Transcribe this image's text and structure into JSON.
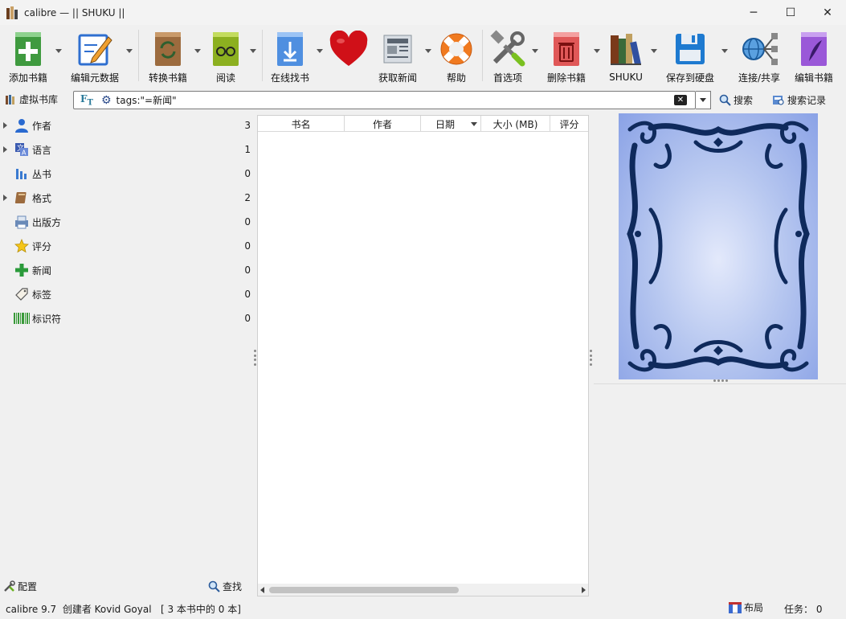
{
  "window": {
    "title": "calibre — || SHUKU ||",
    "minimize": "─",
    "maximize": "☐",
    "close": "✕"
  },
  "toolbar": {
    "items": [
      {
        "label": "添加书籍",
        "icon": "add-book-icon"
      },
      {
        "label": "编辑元数据",
        "icon": "edit-metadata-icon"
      },
      {
        "label": "转换书籍",
        "icon": "convert-book-icon"
      },
      {
        "label": "阅读",
        "icon": "read-book-icon"
      },
      {
        "label": "在线找书",
        "icon": "get-books-icon"
      },
      {
        "label": "",
        "icon": "heart-icon"
      },
      {
        "label": "获取新闻",
        "icon": "fetch-news-icon"
      },
      {
        "label": "帮助",
        "icon": "help-lifebuoy-icon"
      },
      {
        "label": "首选项",
        "icon": "preferences-tools-icon"
      },
      {
        "label": "删除书籍",
        "icon": "remove-book-icon"
      },
      {
        "label": "SHUKU",
        "icon": "library-books-icon"
      },
      {
        "label": "保存到硬盘",
        "icon": "save-floppy-icon"
      },
      {
        "label": "连接/共享",
        "icon": "connect-share-icon"
      },
      {
        "label": "编辑书籍",
        "icon": "edit-book-icon"
      }
    ]
  },
  "search": {
    "virtual_library": "虚拟书库",
    "query": "tags:\"=新闻\"",
    "search_label": "搜索",
    "history_label": "搜索记录"
  },
  "tag_browser": {
    "items": [
      {
        "label": "作者",
        "count": "3"
      },
      {
        "label": "语言",
        "count": "1"
      },
      {
        "label": "丛书",
        "count": "0"
      },
      {
        "label": "格式",
        "count": "2"
      },
      {
        "label": "出版方",
        "count": "0"
      },
      {
        "label": "评分",
        "count": "0"
      },
      {
        "label": "新闻",
        "count": "0"
      },
      {
        "label": "标签",
        "count": "0"
      },
      {
        "label": "标识符",
        "count": "0"
      }
    ],
    "configure_label": "配置",
    "find_label": "查找"
  },
  "book_list": {
    "columns": [
      "书名",
      "作者",
      "日期",
      "大小 (MB)",
      "评分"
    ]
  },
  "status": {
    "left": "calibre 9.7  创建者 Kovid Goyal   [ 3 本书中的 0 本]",
    "layout_label": "布局",
    "jobs": "任务： 0"
  },
  "colors": {
    "cover_border": "#0f2a5c",
    "cover_light": "#e3e9fb",
    "cover_dark": "#8aa2e6"
  }
}
